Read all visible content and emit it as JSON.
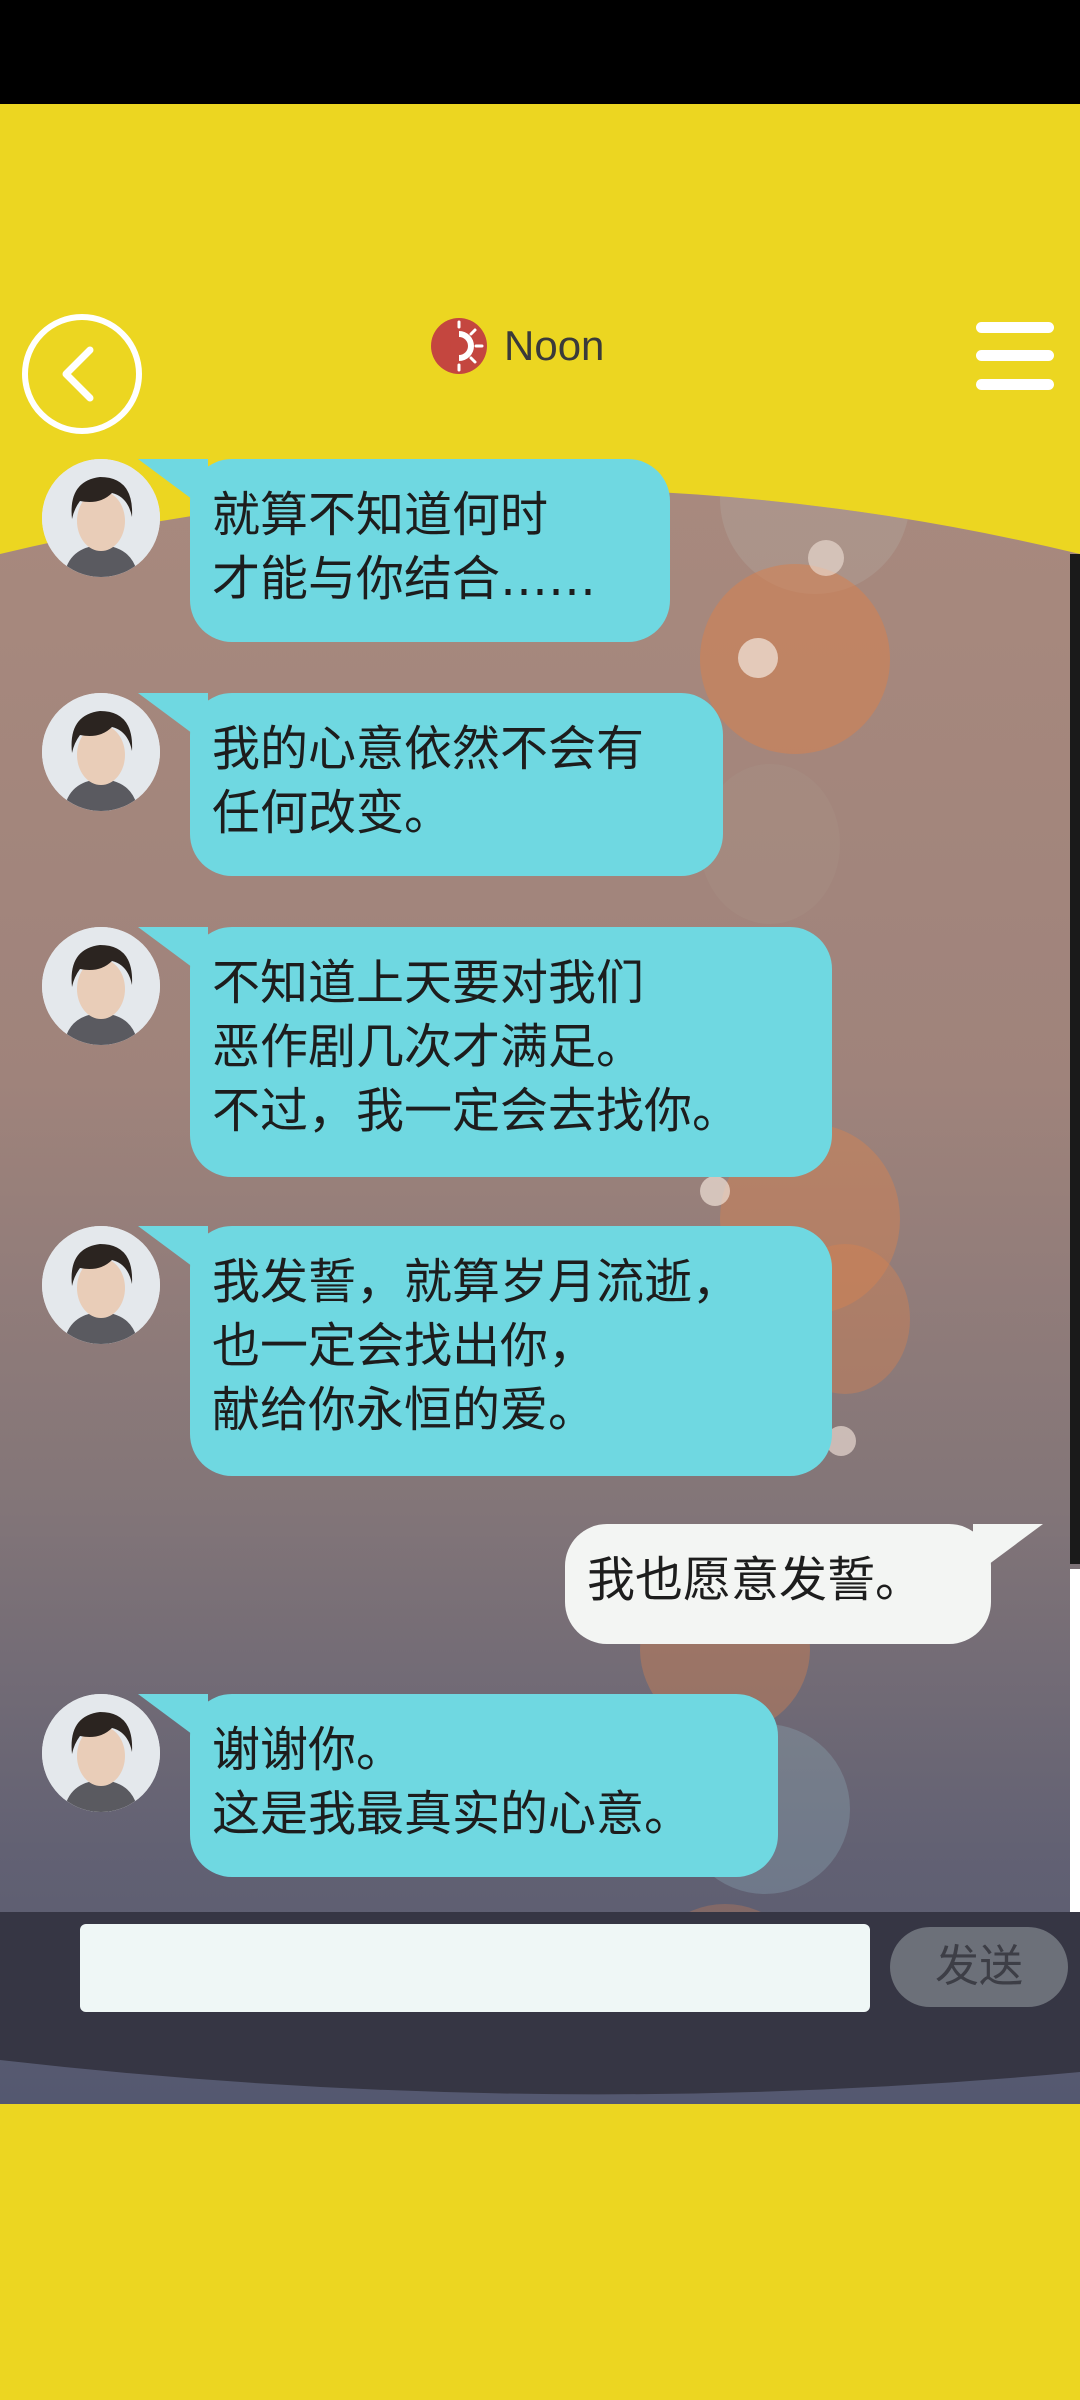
{
  "header": {
    "title": "Noon",
    "back_icon": "chevron-left-icon",
    "menu_icon": "hamburger-menu-icon",
    "title_icon": "sun-icon"
  },
  "messages": [
    {
      "from": "them",
      "text": "就算不知道何时\n才能与你结合……"
    },
    {
      "from": "them",
      "text": "我的心意依然不会有\n任何改变。"
    },
    {
      "from": "them",
      "text": "不知道上天要对我们\n恶作剧几次才满足。\n不过，我一定会去找你。"
    },
    {
      "from": "them",
      "text": "我发誓，就算岁月流逝，\n也一定会找出你，\n献给你永恒的爱。"
    },
    {
      "from": "me",
      "text": "我也愿意发誓。"
    },
    {
      "from": "them",
      "text": "谢谢你。\n这是我最真实的心意。"
    }
  ],
  "composer": {
    "input_value": "",
    "send_label": "发送"
  },
  "colors": {
    "app_background": "#ecd621",
    "incoming_bubble": "#6fd8e1",
    "outgoing_bubble": "#f3f5f3",
    "input_bar": "#363644",
    "send_button": "#6c7079"
  }
}
